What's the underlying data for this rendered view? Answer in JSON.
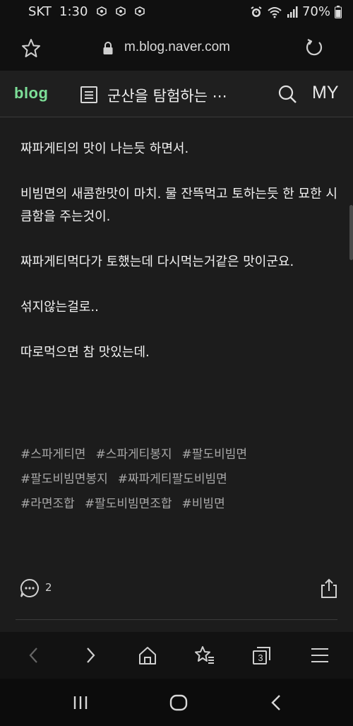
{
  "status_bar": {
    "carrier": "SKT",
    "time": "1:30",
    "battery": "70%"
  },
  "browser": {
    "url": "m.blog.naver.com",
    "tab_count": "3"
  },
  "blog_header": {
    "logo": "blog",
    "title": "군산을 탐험하는 ⋯",
    "my_label": "MY"
  },
  "article": {
    "paragraphs": [
      "짜파게티의 맛이 나는듯 하면서.",
      "비빔면의 새콤한맛이 마치. 물 잔뜩먹고 토하는듯 한 묘한 시큼함을 주는것이.",
      "짜파게티먹다가 토했는데 다시먹는거같은 맛이군요.",
      "섞지않는걸로..",
      "따로먹으면 참 맛있는데."
    ]
  },
  "tags": [
    [
      "#스파게티면",
      "#스파게티봉지",
      "#팔도비빔면"
    ],
    [
      "#팔도비빔면봉지",
      "#짜파게티팔도비빔면"
    ],
    [
      "#라면조합",
      "#팔도비빔면조합",
      "#비빔면"
    ]
  ],
  "comments": {
    "count": "2"
  },
  "colors": {
    "background": "#1c1c1c",
    "logo_green": "#7ddf98",
    "tag_gray": "#a8a8a8"
  }
}
